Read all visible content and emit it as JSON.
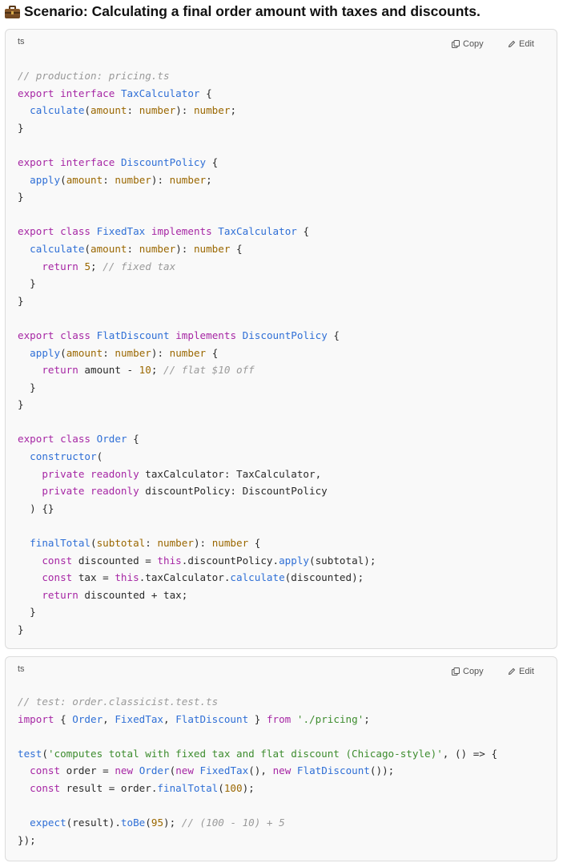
{
  "heading": "Scenario: Calculating a final order amount with taxes and discounts.",
  "code_blocks": [
    {
      "language": "ts",
      "copy_label": "Copy",
      "edit_label": "Edit",
      "lines": [
        [
          [
            "// production: pricing.ts",
            "cm"
          ]
        ],
        [
          [
            "export",
            "kw"
          ],
          [
            " ",
            ""
          ],
          [
            "interface",
            "kw"
          ],
          [
            " ",
            ""
          ],
          [
            "TaxCalculator",
            "ty"
          ],
          [
            " {",
            ""
          ]
        ],
        [
          [
            "  ",
            ""
          ],
          [
            "calculate",
            "fn"
          ],
          [
            "(",
            ""
          ],
          [
            "amount",
            "pa"
          ],
          [
            ": ",
            ""
          ],
          [
            "number",
            "pa"
          ],
          [
            "): ",
            ""
          ],
          [
            "number",
            "pa"
          ],
          [
            ";",
            ""
          ]
        ],
        [
          [
            "}",
            ""
          ]
        ],
        [
          [
            "",
            ""
          ]
        ],
        [
          [
            "export",
            "kw"
          ],
          [
            " ",
            ""
          ],
          [
            "interface",
            "kw"
          ],
          [
            " ",
            ""
          ],
          [
            "DiscountPolicy",
            "ty"
          ],
          [
            " {",
            ""
          ]
        ],
        [
          [
            "  ",
            ""
          ],
          [
            "apply",
            "fn"
          ],
          [
            "(",
            ""
          ],
          [
            "amount",
            "pa"
          ],
          [
            ": ",
            ""
          ],
          [
            "number",
            "pa"
          ],
          [
            "): ",
            ""
          ],
          [
            "number",
            "pa"
          ],
          [
            ";",
            ""
          ]
        ],
        [
          [
            "}",
            ""
          ]
        ],
        [
          [
            "",
            ""
          ]
        ],
        [
          [
            "export",
            "kw"
          ],
          [
            " ",
            ""
          ],
          [
            "class",
            "kw"
          ],
          [
            " ",
            ""
          ],
          [
            "FixedTax",
            "ty"
          ],
          [
            " ",
            ""
          ],
          [
            "implements",
            "kw"
          ],
          [
            " ",
            ""
          ],
          [
            "TaxCalculator",
            "ty"
          ],
          [
            " {",
            ""
          ]
        ],
        [
          [
            "  ",
            ""
          ],
          [
            "calculate",
            "fn"
          ],
          [
            "(",
            ""
          ],
          [
            "amount",
            "pa"
          ],
          [
            ": ",
            ""
          ],
          [
            "number",
            "pa"
          ],
          [
            "): ",
            ""
          ],
          [
            "number",
            "pa"
          ],
          [
            " {",
            ""
          ]
        ],
        [
          [
            "    ",
            ""
          ],
          [
            "return",
            "kw"
          ],
          [
            " ",
            ""
          ],
          [
            "5",
            "nm"
          ],
          [
            "; ",
            ""
          ],
          [
            "// fixed tax",
            "cm"
          ]
        ],
        [
          [
            "  }",
            ""
          ]
        ],
        [
          [
            "}",
            ""
          ]
        ],
        [
          [
            "",
            ""
          ]
        ],
        [
          [
            "export",
            "kw"
          ],
          [
            " ",
            ""
          ],
          [
            "class",
            "kw"
          ],
          [
            " ",
            ""
          ],
          [
            "FlatDiscount",
            "ty"
          ],
          [
            " ",
            ""
          ],
          [
            "implements",
            "kw"
          ],
          [
            " ",
            ""
          ],
          [
            "DiscountPolicy",
            "ty"
          ],
          [
            " {",
            ""
          ]
        ],
        [
          [
            "  ",
            ""
          ],
          [
            "apply",
            "fn"
          ],
          [
            "(",
            ""
          ],
          [
            "amount",
            "pa"
          ],
          [
            ": ",
            ""
          ],
          [
            "number",
            "pa"
          ],
          [
            "): ",
            ""
          ],
          [
            "number",
            "pa"
          ],
          [
            " {",
            ""
          ]
        ],
        [
          [
            "    ",
            ""
          ],
          [
            "return",
            "kw"
          ],
          [
            " amount - ",
            ""
          ],
          [
            "10",
            "nm"
          ],
          [
            "; ",
            ""
          ],
          [
            "// flat $10 off",
            "cm"
          ]
        ],
        [
          [
            "  }",
            ""
          ]
        ],
        [
          [
            "}",
            ""
          ]
        ],
        [
          [
            "",
            ""
          ]
        ],
        [
          [
            "export",
            "kw"
          ],
          [
            " ",
            ""
          ],
          [
            "class",
            "kw"
          ],
          [
            " ",
            ""
          ],
          [
            "Order",
            "ty"
          ],
          [
            " {",
            ""
          ]
        ],
        [
          [
            "  ",
            ""
          ],
          [
            "constructor",
            "fn"
          ],
          [
            "(",
            ""
          ]
        ],
        [
          [
            "    ",
            ""
          ],
          [
            "private",
            "kw"
          ],
          [
            " ",
            ""
          ],
          [
            "readonly",
            "kw"
          ],
          [
            " taxCalculator: TaxCalculator,",
            ""
          ]
        ],
        [
          [
            "    ",
            ""
          ],
          [
            "private",
            "kw"
          ],
          [
            " ",
            ""
          ],
          [
            "readonly",
            "kw"
          ],
          [
            " discountPolicy: DiscountPolicy",
            ""
          ]
        ],
        [
          [
            "  ) {}",
            ""
          ]
        ],
        [
          [
            "",
            ""
          ]
        ],
        [
          [
            "  ",
            ""
          ],
          [
            "finalTotal",
            "fn"
          ],
          [
            "(",
            ""
          ],
          [
            "subtotal",
            "pa"
          ],
          [
            ": ",
            ""
          ],
          [
            "number",
            "pa"
          ],
          [
            "): ",
            ""
          ],
          [
            "number",
            "pa"
          ],
          [
            " {",
            ""
          ]
        ],
        [
          [
            "    ",
            ""
          ],
          [
            "const",
            "kw"
          ],
          [
            " discounted = ",
            ""
          ],
          [
            "this",
            "kw"
          ],
          [
            ".discountPolicy.",
            ""
          ],
          [
            "apply",
            "fn"
          ],
          [
            "(subtotal);",
            ""
          ]
        ],
        [
          [
            "    ",
            ""
          ],
          [
            "const",
            "kw"
          ],
          [
            " tax = ",
            ""
          ],
          [
            "this",
            "kw"
          ],
          [
            ".taxCalculator.",
            ""
          ],
          [
            "calculate",
            "fn"
          ],
          [
            "(discounted);",
            ""
          ]
        ],
        [
          [
            "    ",
            ""
          ],
          [
            "return",
            "kw"
          ],
          [
            " discounted + tax;",
            ""
          ]
        ],
        [
          [
            "  }",
            ""
          ]
        ],
        [
          [
            "}",
            ""
          ]
        ]
      ]
    },
    {
      "language": "ts",
      "copy_label": "Copy",
      "edit_label": "Edit",
      "lines": [
        [
          [
            "// test: order.classicist.test.ts",
            "cm"
          ]
        ],
        [
          [
            "import",
            "kw"
          ],
          [
            " { ",
            ""
          ],
          [
            "Order",
            "ty"
          ],
          [
            ", ",
            ""
          ],
          [
            "FixedTax",
            "ty"
          ],
          [
            ", ",
            ""
          ],
          [
            "FlatDiscount",
            "ty"
          ],
          [
            " } ",
            ""
          ],
          [
            "from",
            "kw"
          ],
          [
            " ",
            ""
          ],
          [
            "'./pricing'",
            "st"
          ],
          [
            ";",
            ""
          ]
        ],
        [
          [
            "",
            ""
          ]
        ],
        [
          [
            "test",
            "fn"
          ],
          [
            "(",
            ""
          ],
          [
            "'computes total with fixed tax and flat discount (Chicago-style)'",
            "st"
          ],
          [
            ", () => {",
            ""
          ]
        ],
        [
          [
            "  ",
            ""
          ],
          [
            "const",
            "kw"
          ],
          [
            " order = ",
            ""
          ],
          [
            "new",
            "kw"
          ],
          [
            " ",
            ""
          ],
          [
            "Order",
            "ty"
          ],
          [
            "(",
            ""
          ],
          [
            "new",
            "kw"
          ],
          [
            " ",
            ""
          ],
          [
            "FixedTax",
            "ty"
          ],
          [
            "(), ",
            ""
          ],
          [
            "new",
            "kw"
          ],
          [
            " ",
            ""
          ],
          [
            "FlatDiscount",
            "ty"
          ],
          [
            "());",
            ""
          ]
        ],
        [
          [
            "  ",
            ""
          ],
          [
            "const",
            "kw"
          ],
          [
            " result = order.",
            ""
          ],
          [
            "finalTotal",
            "fn"
          ],
          [
            "(",
            ""
          ],
          [
            "100",
            "nm"
          ],
          [
            ");",
            ""
          ]
        ],
        [
          [
            "",
            ""
          ]
        ],
        [
          [
            "  ",
            ""
          ],
          [
            "expect",
            "fn"
          ],
          [
            "(result).",
            ""
          ],
          [
            "toBe",
            "fn"
          ],
          [
            "(",
            ""
          ],
          [
            "95",
            "nm"
          ],
          [
            "); ",
            ""
          ],
          [
            "// (100 - 10) + 5",
            "cm"
          ]
        ],
        [
          [
            "});",
            ""
          ]
        ]
      ]
    }
  ]
}
